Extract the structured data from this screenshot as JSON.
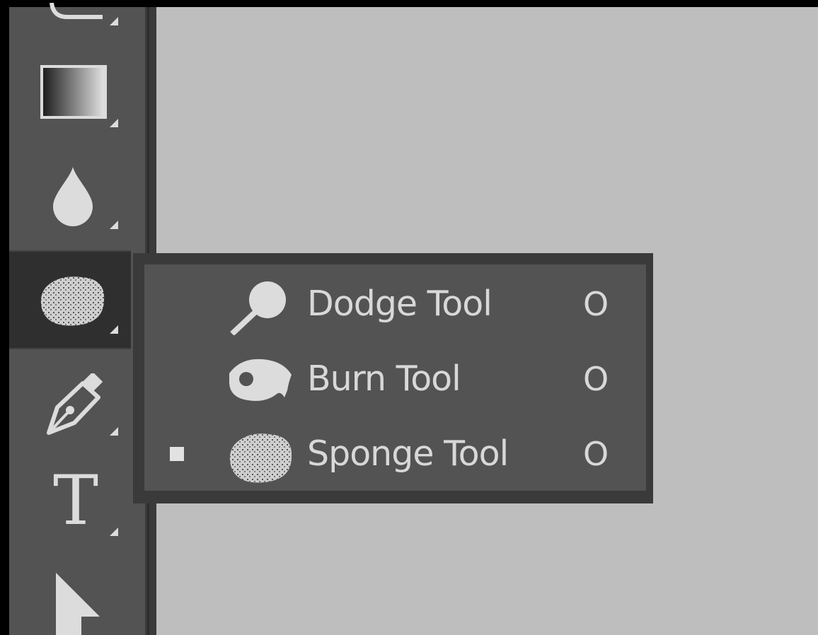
{
  "toolbar": {
    "tools": [
      {
        "icon": "clone-stamp-icon"
      },
      {
        "icon": "gradient-icon"
      },
      {
        "icon": "blur-icon"
      },
      {
        "icon": "sponge-icon",
        "active": true
      },
      {
        "icon": "pen-icon"
      },
      {
        "icon": "type-icon",
        "glyph": "T"
      },
      {
        "icon": "path-selection-icon"
      }
    ]
  },
  "flyout": {
    "items": [
      {
        "label": "Dodge Tool",
        "shortcut": "O",
        "icon": "dodge-icon",
        "selected": false
      },
      {
        "label": "Burn Tool",
        "shortcut": "O",
        "icon": "burn-icon",
        "selected": false
      },
      {
        "label": "Sponge Tool",
        "shortcut": "O",
        "icon": "sponge-icon",
        "selected": true
      }
    ]
  },
  "colors": {
    "canvas": "#bebebe",
    "toolbar": "#535353",
    "active_tool": "#2f2f2f",
    "text": "#d8d8d8"
  }
}
